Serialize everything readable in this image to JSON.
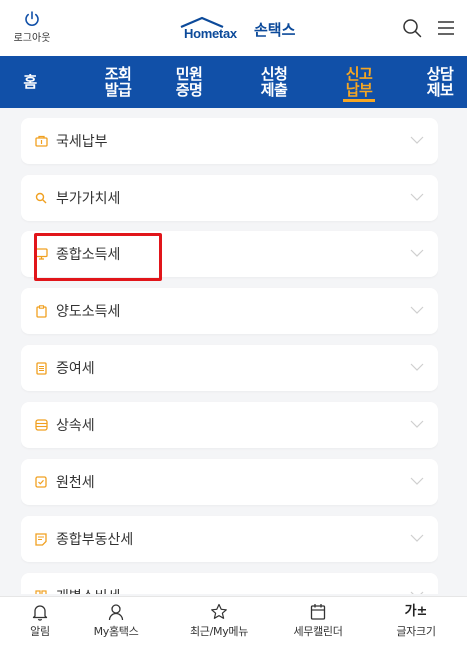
{
  "header": {
    "logout_label": "로그아웃",
    "brand_wordmark": "Hometax",
    "brand_text": "손택스"
  },
  "nav": {
    "items": [
      {
        "line1": "홈",
        "line2": ""
      },
      {
        "line1": "조회",
        "line2": "발급"
      },
      {
        "line1": "민원",
        "line2": "증명"
      },
      {
        "line1": "신청",
        "line2": "제출"
      },
      {
        "line1": "신고",
        "line2": "납부"
      },
      {
        "line1": "상담",
        "line2": "제보"
      }
    ],
    "active_index": 4,
    "active_color": "#f5a623",
    "background": "#1150a8"
  },
  "list": {
    "items": [
      {
        "label": "국세납부",
        "icon": "wallet-icon"
      },
      {
        "label": "부가가치세",
        "icon": "search-icon"
      },
      {
        "label": "종합소득세",
        "icon": "monitor-icon"
      },
      {
        "label": "양도소득세",
        "icon": "clipboard-icon"
      },
      {
        "label": "증여세",
        "icon": "document-icon"
      },
      {
        "label": "상속세",
        "icon": "database-icon"
      },
      {
        "label": "원천세",
        "icon": "checkbox-icon"
      },
      {
        "label": "종합부동산세",
        "icon": "note-icon"
      },
      {
        "label": "개별소비세",
        "icon": "grid-icon"
      }
    ],
    "highlighted": "종합소득세",
    "icon_color": "#f0a020",
    "highlight_color": "#e1151a"
  },
  "bottom_bar": {
    "items": [
      {
        "label": "알림",
        "icon": "bell-icon"
      },
      {
        "label": "My홈택스",
        "icon": "user-icon"
      },
      {
        "label": "최근/My메뉴",
        "icon": "star-icon"
      },
      {
        "label": "세무캘린더",
        "icon": "calendar-icon"
      },
      {
        "label": "글자크기",
        "icon": "font-size-icon",
        "glyph": "가±"
      }
    ]
  }
}
